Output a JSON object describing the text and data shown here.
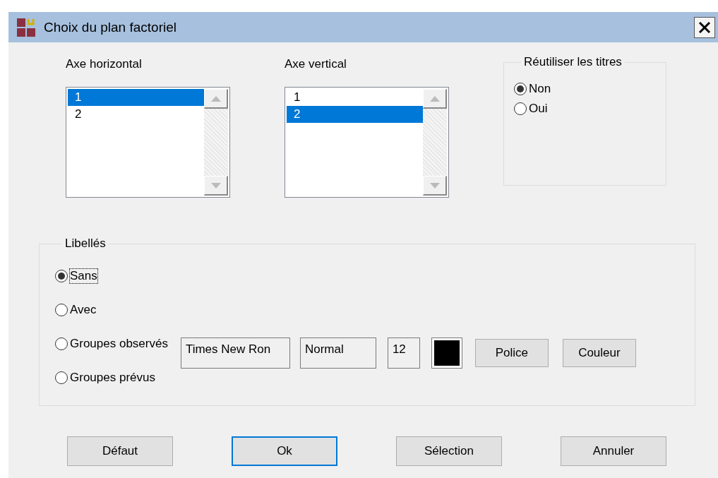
{
  "window": {
    "title": "Choix du plan factoriel"
  },
  "axes": [
    {
      "label": "Axe horizontal",
      "items": [
        {
          "text": "1",
          "selected": true
        },
        {
          "text": "2",
          "selected": false
        }
      ]
    },
    {
      "label": "Axe vertical",
      "items": [
        {
          "text": "1",
          "selected": false
        },
        {
          "text": "2",
          "selected": true
        }
      ]
    }
  ],
  "reuse_titles": {
    "legend": "Réutiliser les titres",
    "options": [
      {
        "label": "Non",
        "selected": true
      },
      {
        "label": "Oui",
        "selected": false
      }
    ]
  },
  "labels": {
    "legend": "Libellés",
    "options": [
      {
        "label": "Sans",
        "selected": true,
        "focused": true
      },
      {
        "label": "Avec",
        "selected": false,
        "focused": false
      },
      {
        "label": "Groupes observés",
        "selected": false,
        "focused": false
      },
      {
        "label": "Groupes prévus",
        "selected": false,
        "focused": false
      }
    ],
    "font_name": "Times New Ron",
    "font_style": "Normal",
    "font_size": "12",
    "color": "#000000",
    "buttons": [
      "Police",
      "Couleur"
    ]
  },
  "buttons": [
    {
      "label": "Défaut",
      "default": false
    },
    {
      "label": "Ok",
      "default": true
    },
    {
      "label": "Sélection",
      "default": false
    },
    {
      "label": "Annuler",
      "default": false
    }
  ]
}
